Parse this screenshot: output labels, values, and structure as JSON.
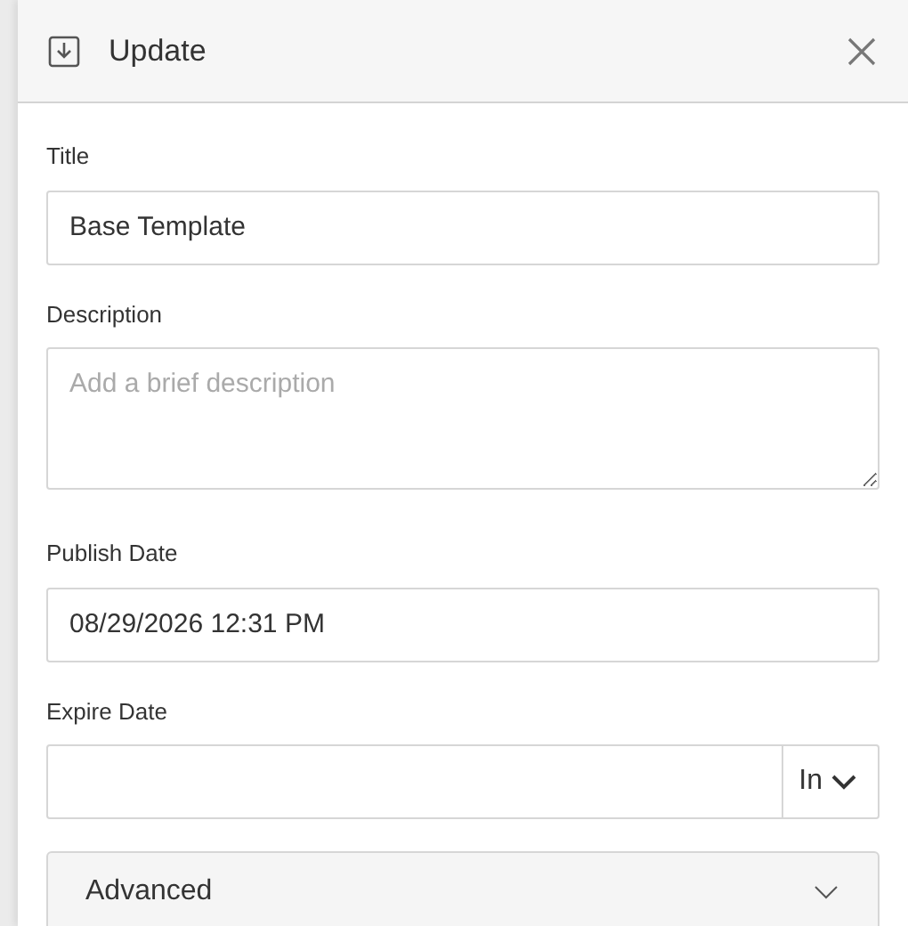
{
  "panel": {
    "title": "Update"
  },
  "fields": [
    {
      "kind": "text",
      "label": "Title",
      "value": "Base Template"
    },
    {
      "kind": "textarea",
      "label": "Description",
      "placeholder": "Add a brief description"
    },
    {
      "kind": "text",
      "label": "Publish Date",
      "value": "08/29/2026 12:31 PM"
    },
    {
      "kind": "select-addon",
      "label": "Expire Date",
      "addon": "In"
    }
  ],
  "advanced": {
    "label": "Advanced",
    "expanded": false
  }
}
